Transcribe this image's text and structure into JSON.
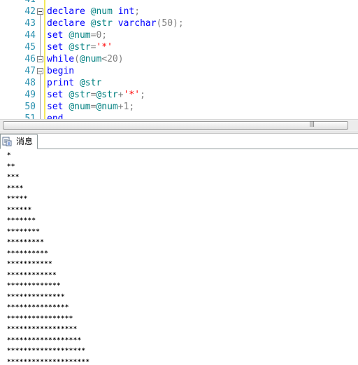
{
  "editor": {
    "lines": [
      {
        "number": "41",
        "tokens": []
      },
      {
        "number": "42",
        "tokens": [
          {
            "t": "declare",
            "c": "kw"
          },
          {
            "t": " ",
            "c": "txt"
          },
          {
            "t": "@num",
            "c": "var"
          },
          {
            "t": " ",
            "c": "txt"
          },
          {
            "t": "int",
            "c": "kw"
          },
          {
            "t": ";",
            "c": "op"
          }
        ]
      },
      {
        "number": "43",
        "tokens": [
          {
            "t": "declare",
            "c": "kw"
          },
          {
            "t": " ",
            "c": "txt"
          },
          {
            "t": "@str",
            "c": "var"
          },
          {
            "t": " ",
            "c": "txt"
          },
          {
            "t": "varchar",
            "c": "kw"
          },
          {
            "t": "(50);",
            "c": "op"
          }
        ]
      },
      {
        "number": "44",
        "tokens": [
          {
            "t": "set",
            "c": "kw"
          },
          {
            "t": " ",
            "c": "txt"
          },
          {
            "t": "@num",
            "c": "var"
          },
          {
            "t": "=0;",
            "c": "op"
          }
        ]
      },
      {
        "number": "45",
        "tokens": [
          {
            "t": "set",
            "c": "kw"
          },
          {
            "t": " ",
            "c": "txt"
          },
          {
            "t": "@str",
            "c": "var"
          },
          {
            "t": "=",
            "c": "op"
          },
          {
            "t": "'*'",
            "c": "str"
          }
        ]
      },
      {
        "number": "46",
        "tokens": [
          {
            "t": "while",
            "c": "kw"
          },
          {
            "t": "(",
            "c": "op"
          },
          {
            "t": "@num",
            "c": "var"
          },
          {
            "t": "<20)",
            "c": "op"
          }
        ]
      },
      {
        "number": "47",
        "tokens": [
          {
            "t": "begin",
            "c": "kw"
          }
        ]
      },
      {
        "number": "48",
        "tokens": [
          {
            "t": "print",
            "c": "kw"
          },
          {
            "t": " ",
            "c": "txt"
          },
          {
            "t": "@str",
            "c": "var"
          }
        ]
      },
      {
        "number": "49",
        "tokens": [
          {
            "t": "set",
            "c": "kw"
          },
          {
            "t": " ",
            "c": "txt"
          },
          {
            "t": "@str",
            "c": "var"
          },
          {
            "t": "=",
            "c": "op"
          },
          {
            "t": "@str",
            "c": "var"
          },
          {
            "t": "+",
            "c": "op"
          },
          {
            "t": "'*'",
            "c": "str"
          },
          {
            "t": ";",
            "c": "op"
          }
        ]
      },
      {
        "number": "50",
        "tokens": [
          {
            "t": "set",
            "c": "kw"
          },
          {
            "t": " ",
            "c": "txt"
          },
          {
            "t": "@num",
            "c": "var"
          },
          {
            "t": "=",
            "c": "op"
          },
          {
            "t": "@num",
            "c": "var"
          },
          {
            "t": "+1;",
            "c": "op"
          }
        ]
      },
      {
        "number": "51",
        "tokens": [
          {
            "t": "end",
            "c": "kw"
          }
        ]
      }
    ]
  },
  "results": {
    "tab_label": "消息",
    "tab_icon": "messages-icon",
    "messages": [
      "*",
      "**",
      "***",
      "****",
      "*****",
      "******",
      "*******",
      "********",
      "*********",
      "**********",
      "***********",
      "************",
      "*************",
      "**************",
      "***************",
      "****************",
      "*****************",
      "******************",
      "*******************",
      "********************"
    ]
  },
  "colors": {
    "keyword": "#0000ff",
    "variable": "#008080",
    "string": "#ff0000",
    "operator": "#808080",
    "line_number": "#2b91af",
    "change_bar": "#f5e85a"
  }
}
